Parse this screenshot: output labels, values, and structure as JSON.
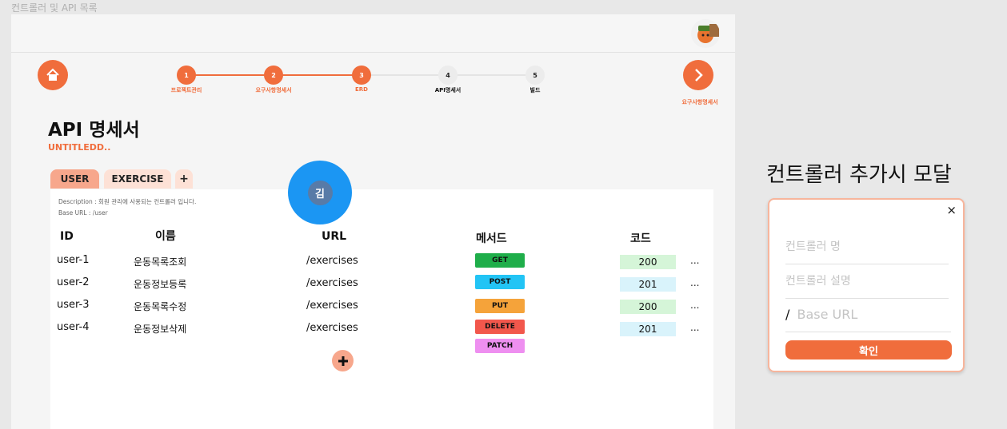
{
  "frame_label": "컨트롤러 및 API 목록",
  "header": {
    "avatar": "user-avatar"
  },
  "stepper": {
    "steps": [
      {
        "number": "1",
        "label": "프로젝트관리",
        "state": "done"
      },
      {
        "number": "2",
        "label": "요구사항명세서",
        "state": "done"
      },
      {
        "number": "3",
        "label": "ERD",
        "state": "done"
      },
      {
        "number": "4",
        "label": "API명세서",
        "state": "current"
      },
      {
        "number": "5",
        "label": "빌드",
        "state": "todo"
      }
    ],
    "next_label": "요구사항명세서"
  },
  "page": {
    "title": "API 명세서",
    "project": "UNTITLEDD.."
  },
  "tabs": [
    {
      "label": "USER",
      "active": true
    },
    {
      "label": "EXERCISE",
      "active": false
    },
    {
      "label": "+",
      "active": false
    }
  ],
  "controller": {
    "description": "Description : 회원 관리에 사용되는 컨트롤러 입니다.",
    "base_url": "Base URL : /user"
  },
  "table": {
    "headers": {
      "id": "ID",
      "name": "이름",
      "url": "URL",
      "method": "메서드",
      "code": "코드"
    },
    "rows": [
      {
        "id": "user-1",
        "name": "운동목록조회",
        "url": "/exercises",
        "code": "200",
        "more": "..."
      },
      {
        "id": "user-2",
        "name": "운동정보등록",
        "url": "/exercises",
        "code": "201",
        "more": "..."
      },
      {
        "id": "user-3",
        "name": "운동목록수정",
        "url": "/exercises",
        "code": "200",
        "more": "..."
      },
      {
        "id": "user-4",
        "name": "운동정보삭제",
        "url": "/exercises",
        "code": "201",
        "more": "..."
      }
    ],
    "methods": [
      {
        "label": "GET",
        "color": "#1fae4a"
      },
      {
        "label": "POST",
        "color": "#22c4f5"
      },
      {
        "label": "PUT",
        "color": "#f5a33a"
      },
      {
        "label": "DELETE",
        "color": "#f2574c"
      },
      {
        "label": "PATCH",
        "color": "#ee8ff0"
      }
    ],
    "add_icon": "plus-icon"
  },
  "presence": {
    "initial": "김"
  },
  "modal": {
    "heading": "컨트롤러 추가시 모달",
    "close": "×",
    "name_placeholder": "컨트롤러 명",
    "desc_placeholder": "컨트롤러 설명",
    "url_prefix": "/",
    "url_placeholder": "Base URL",
    "confirm": "확인"
  },
  "colors": {
    "accent": "#f06d3c",
    "code_200_bg": "#d5f5d8",
    "code_201_bg": "#d9f3fb"
  }
}
